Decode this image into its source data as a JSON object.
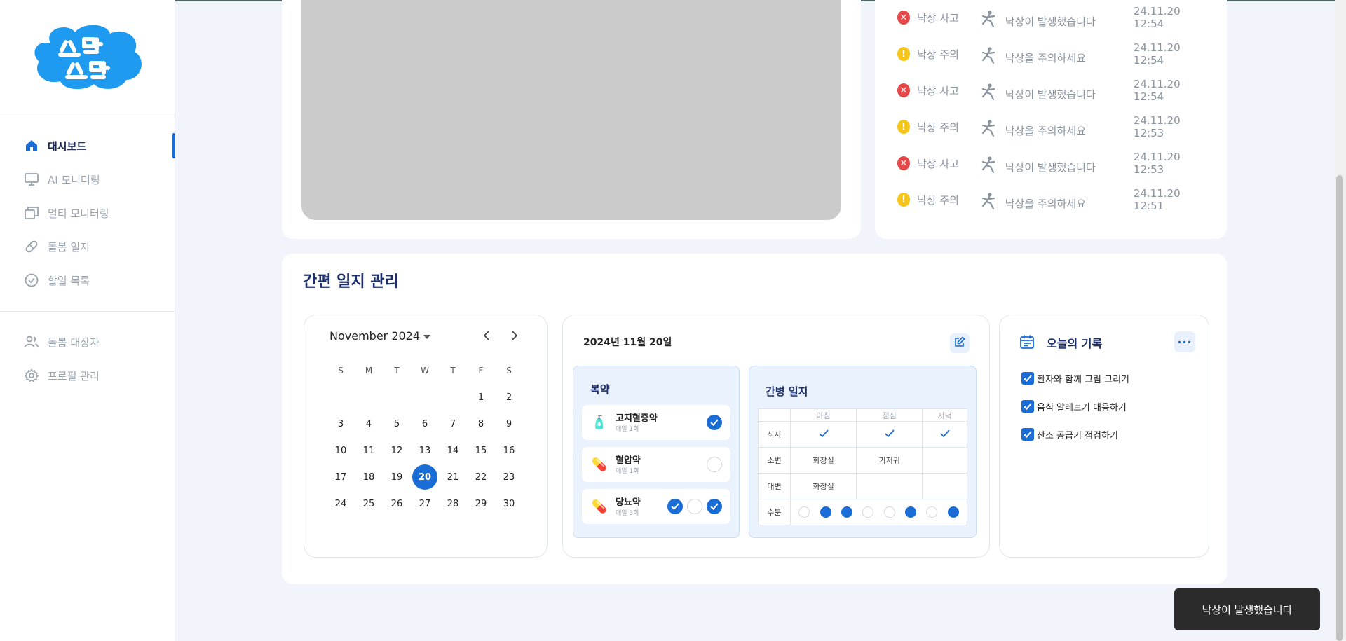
{
  "colors": {
    "accent": "#1a6dd6",
    "danger": "#e54848",
    "warning": "#f5c518",
    "title": "#1c2f6b"
  },
  "sidebar": {
    "items": [
      {
        "label": "대시보드",
        "icon": "home-icon",
        "active": true
      },
      {
        "label": "AI 모니터링",
        "icon": "monitor-icon"
      },
      {
        "label": "멀티 모니터링",
        "icon": "multi-window-icon"
      },
      {
        "label": "돌봄 일지",
        "icon": "pill-icon"
      },
      {
        "label": "할일 목록",
        "icon": "check-circle-icon"
      }
    ],
    "items2": [
      {
        "label": "돌봄 대상자",
        "icon": "users-icon"
      },
      {
        "label": "프로필 관리",
        "icon": "gear-icon"
      }
    ]
  },
  "alerts": [
    {
      "type": "danger",
      "label": "낙상 사고",
      "message": "낙상이 발생했습니다",
      "time": "24.11.20 12:54"
    },
    {
      "type": "warning",
      "label": "낙상 주의",
      "message": "낙상을 주의하세요",
      "time": "24.11.20 12:54"
    },
    {
      "type": "danger",
      "label": "낙상 사고",
      "message": "낙상이 발생했습니다",
      "time": "24.11.20 12:54"
    },
    {
      "type": "warning",
      "label": "낙상 주의",
      "message": "낙상을 주의하세요",
      "time": "24.11.20 12:53"
    },
    {
      "type": "danger",
      "label": "낙상 사고",
      "message": "낙상이 발생했습니다",
      "time": "24.11.20 12:53"
    },
    {
      "type": "warning",
      "label": "낙상 주의",
      "message": "낙상을 주의하세요",
      "time": "24.11.20 12:51"
    }
  ],
  "journal": {
    "title": "간편 일지 관리",
    "calendar": {
      "month_label": "November 2024",
      "weekdays": [
        "S",
        "M",
        "T",
        "W",
        "T",
        "F",
        "S"
      ],
      "weeks": [
        [
          "",
          "",
          "",
          "",
          "",
          "1",
          "2"
        ],
        [
          "3",
          "4",
          "5",
          "6",
          "7",
          "8",
          "9"
        ],
        [
          "10",
          "11",
          "12",
          "13",
          "14",
          "15",
          "16"
        ],
        [
          "17",
          "18",
          "19",
          "20",
          "21",
          "22",
          "23"
        ],
        [
          "24",
          "25",
          "26",
          "27",
          "28",
          "29",
          "30"
        ]
      ],
      "selected": "20"
    },
    "daily": {
      "date": "2024년 11월 20일",
      "medication": {
        "title": "복약",
        "items": [
          {
            "name": "고지혈증약",
            "freq": "매일 1회",
            "pill": "🧴",
            "checks": [
              true
            ]
          },
          {
            "name": "혈압약",
            "freq": "매일 1회",
            "pill": "💊",
            "checks": [
              false
            ]
          },
          {
            "name": "당뇨약",
            "freq": "매일 3회",
            "pill": "💊",
            "checks": [
              true,
              false,
              true
            ]
          }
        ]
      },
      "care": {
        "title": "간병 일지",
        "columns": [
          "아침",
          "점심",
          "저녁"
        ],
        "rows": {
          "meal": {
            "label": "식사",
            "cells": [
              "✓",
              "✓",
              "✓"
            ]
          },
          "urine": {
            "label": "소변",
            "cells": [
              "화장실",
              "기저귀",
              ""
            ]
          },
          "stool": {
            "label": "대변",
            "cells": [
              "화장실",
              "",
              ""
            ]
          },
          "water": {
            "label": "수분",
            "dots": [
              false,
              true,
              true,
              false,
              false,
              true,
              false,
              true
            ]
          }
        }
      }
    },
    "today": {
      "title": "오늘의 기록",
      "more": "···",
      "todos": [
        {
          "label": "환자와 함께 그림 그리기",
          "checked": true
        },
        {
          "label": "음식 알레르기 대응하기",
          "checked": true
        },
        {
          "label": "산소 공급기 점검하기",
          "checked": true
        }
      ]
    }
  },
  "toast": {
    "message": "낙상이 발생했습니다"
  }
}
